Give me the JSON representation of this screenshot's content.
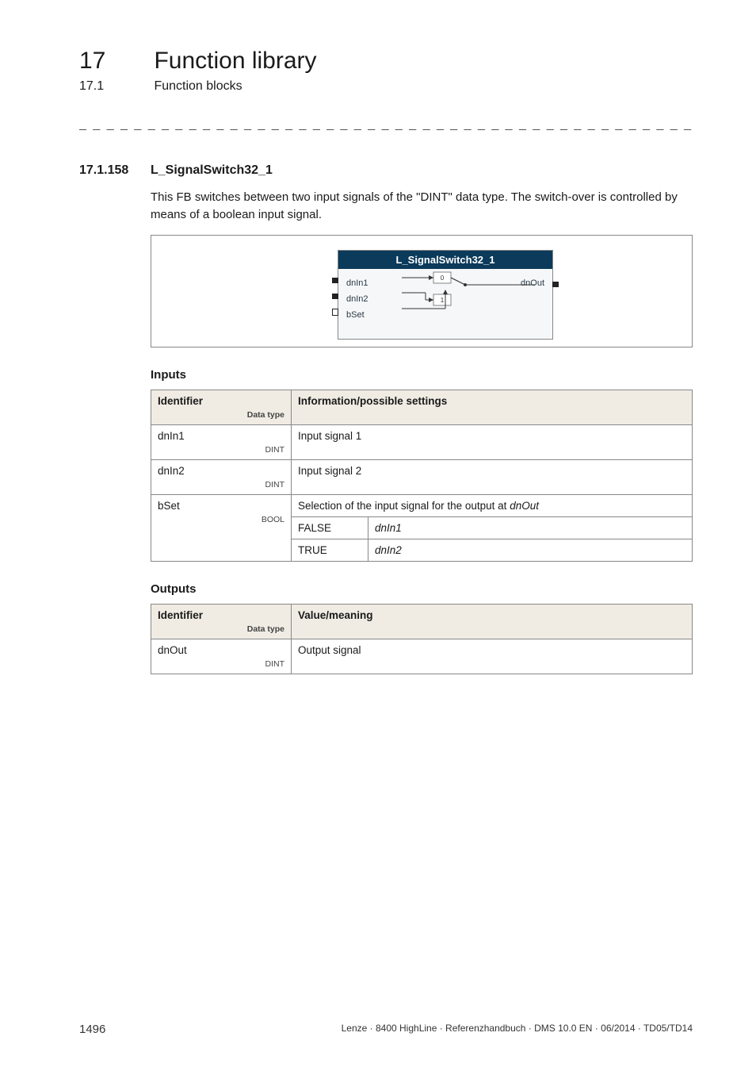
{
  "header": {
    "chapter_num": "17",
    "chapter_title": "Function library",
    "sub_num": "17.1",
    "sub_title": "Function blocks"
  },
  "dashes": "_ _ _ _ _ _ _ _ _ _ _ _ _ _ _ _ _ _ _ _ _ _ _ _ _ _ _ _ _ _ _ _ _ _ _ _ _ _ _ _ _ _ _ _ _ _ _ _ _ _ _ _ _ _ _ _ _ _ _ _ _ _ _ _",
  "section": {
    "num": "17.1.158",
    "title": "L_SignalSwitch32_1",
    "description": "This FB switches between two input signals of the \"DINT\" data type. The switch-over is controlled by means of a boolean input signal."
  },
  "diagram": {
    "fb_title": "L_SignalSwitch32_1",
    "in1": "dnIn1",
    "in2": "dnIn2",
    "sel": "bSet",
    "out": "dnOut",
    "sw0": "0",
    "sw1": "1"
  },
  "inputs": {
    "heading": "Inputs",
    "col_id": "Identifier",
    "col_dt": "Data type",
    "col_info": "Information/possible settings",
    "rows": [
      {
        "id": "dnIn1",
        "dt": "DINT",
        "info": "Input signal 1"
      },
      {
        "id": "dnIn2",
        "dt": "DINT",
        "info": "Input signal 2"
      }
    ],
    "bset": {
      "id": "bSet",
      "dt": "BOOL",
      "info_prefix": "Selection of the input signal for the output at ",
      "info_ital": "dnOut",
      "false_lbl": "FALSE",
      "false_val": "dnIn1",
      "true_lbl": "TRUE",
      "true_val": "dnIn2"
    }
  },
  "outputs": {
    "heading": "Outputs",
    "col_id": "Identifier",
    "col_dt": "Data type",
    "col_info": "Value/meaning",
    "rows": [
      {
        "id": "dnOut",
        "dt": "DINT",
        "info": "Output signal"
      }
    ]
  },
  "footer": {
    "page": "1496",
    "info": "Lenze · 8400 HighLine · Referenzhandbuch · DMS 10.0 EN · 06/2014 · TD05/TD14"
  }
}
